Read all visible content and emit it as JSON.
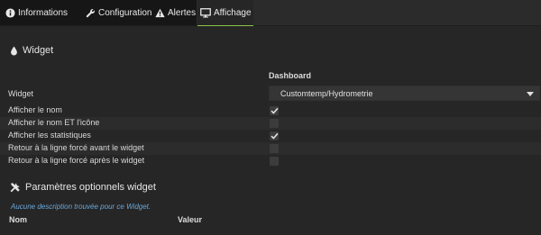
{
  "tabs": [
    {
      "label": "Informations",
      "icon": "info-circle-icon",
      "active": false
    },
    {
      "label": "Configuration",
      "icon": "wrench-icon",
      "active": false
    },
    {
      "label": "Alertes",
      "icon": "warning-icon",
      "active": false
    },
    {
      "label": "Affichage",
      "icon": "monitor-icon",
      "active": true
    }
  ],
  "widget_section": {
    "title": "Widget",
    "icon": "drop-icon",
    "column_header": "Dashboard",
    "widget_label": "Widget",
    "widget_select_value": "Customtemp/Hydrometrie"
  },
  "options": [
    {
      "label": "Afficher le nom",
      "checked": true
    },
    {
      "label": "Afficher le nom ET l'icône",
      "checked": false
    },
    {
      "label": "Afficher les statistiques",
      "checked": true
    },
    {
      "label": "Retour à la ligne forcé avant le widget",
      "checked": false
    },
    {
      "label": "Retour à la ligne forcé après le widget",
      "checked": false
    }
  ],
  "params_section": {
    "title": "Paramètres optionnels widget",
    "icon": "tools-icon",
    "no_description": "Aucune description trouvée pour ce Widget.",
    "col_name": "Nom",
    "col_value": "Valeur"
  },
  "colors": {
    "background": "#262626",
    "active_tab_underline": "#8bc34a",
    "link_text": "#6aa7d8"
  }
}
